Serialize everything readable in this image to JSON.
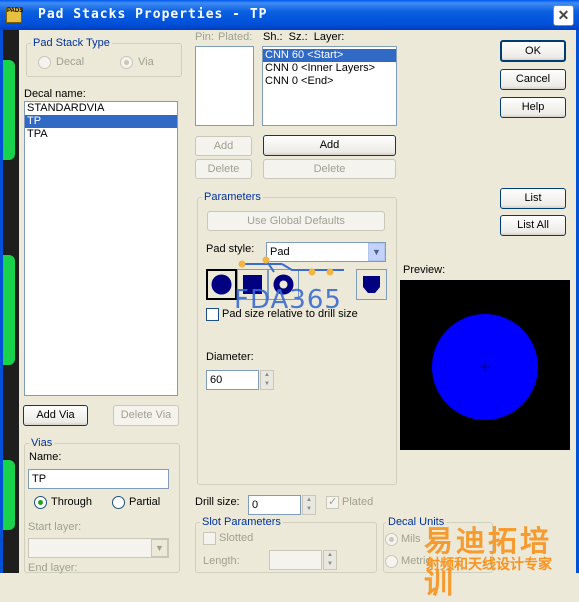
{
  "window": {
    "title": "Pad Stacks Properties - TP",
    "icon_text": "PADS",
    "close_glyph": "✕"
  },
  "pad_stack_type": {
    "legend": "Pad Stack Type",
    "decal": "Decal",
    "via": "Via"
  },
  "decal": {
    "label": "Decal name:",
    "items": [
      "STANDARDVIA",
      "TP",
      "TPA"
    ],
    "selected_index": 1
  },
  "decal_buttons": {
    "add_via": "Add Via",
    "delete_via": "Delete Via"
  },
  "vias": {
    "legend": "Vias",
    "name_label": "Name:",
    "name_value": "TP",
    "through": "Through",
    "partial": "Partial",
    "start_layer_label": "Start layer:",
    "end_layer_label": "End layer:"
  },
  "pin_table": {
    "header_pin": "Pin:",
    "header_plated": "Plated:",
    "add": "Add",
    "delete": "Delete"
  },
  "layer_table": {
    "header": "Sh.:  Sz.:  Layer:",
    "items": [
      "CNN 60 <Start>",
      "CNN 0 <Inner Layers>",
      "CNN 0 <End>"
    ],
    "selected_index": 0,
    "add": "Add",
    "delete": "Delete"
  },
  "parameters": {
    "legend": "Parameters",
    "use_global": "Use Global Defaults",
    "pad_style_label": "Pad style:",
    "pad_style_value": "Pad",
    "relative_label": "Pad size relative to drill size",
    "diameter_label": "Diameter:",
    "diameter_value": "60"
  },
  "drill": {
    "label": "Drill size:",
    "value": "0",
    "plated": "Plated"
  },
  "slot": {
    "legend": "Slot Parameters",
    "slotted": "Slotted",
    "length_label": "Length:"
  },
  "units": {
    "legend": "Decal Units",
    "mils": "Mils",
    "metric": "Metric"
  },
  "actions": {
    "ok": "OK",
    "cancel": "Cancel",
    "help": "Help",
    "list": "List",
    "list_all": "List All"
  },
  "preview": {
    "label": "Preview:",
    "pad_color": "#0000ff",
    "background": "#000000"
  },
  "watermarks": {
    "fda": "FDA365",
    "cn_big": "易迪拓培训",
    "cn_small": "射频和天线设计专家"
  },
  "colors": {
    "title_blue": "#0a5fe0",
    "selection": "#316ac5",
    "dialog_bg": "#ece9d8"
  }
}
